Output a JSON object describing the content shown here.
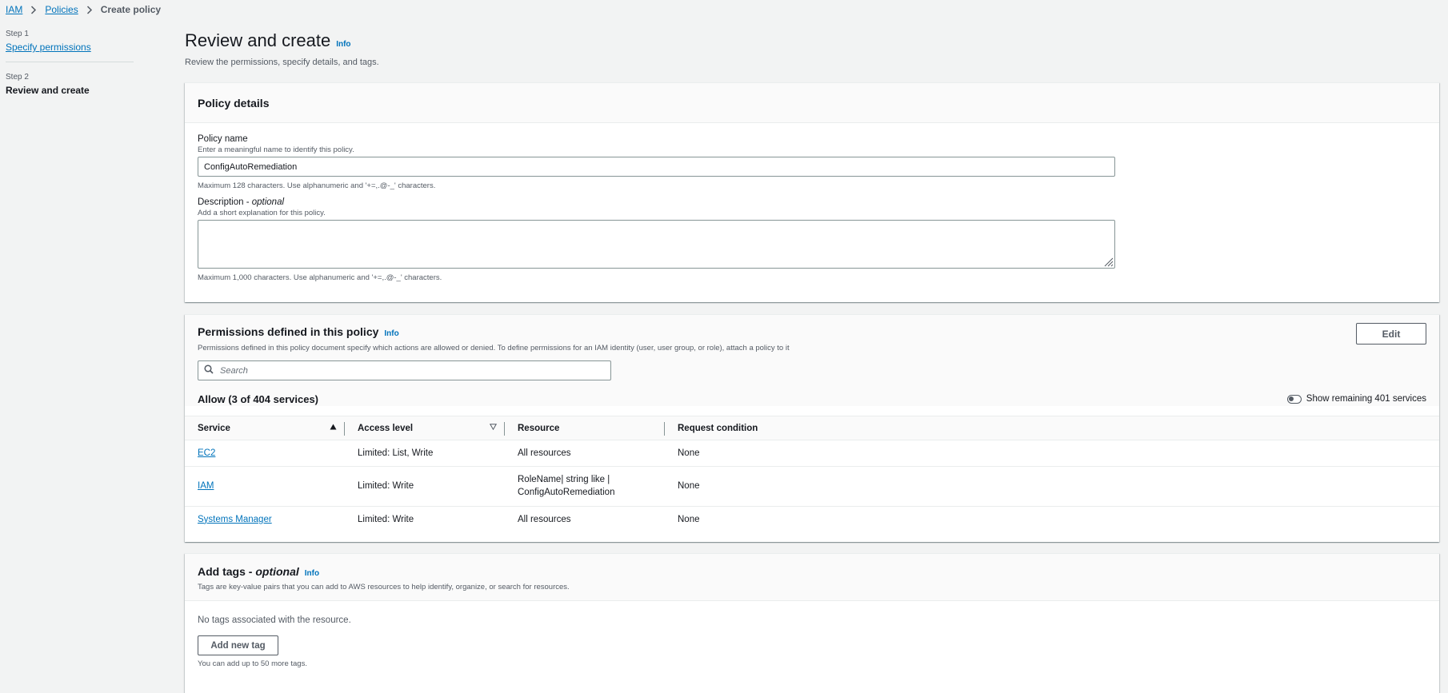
{
  "breadcrumb": {
    "iam": "IAM",
    "policies": "Policies",
    "current": "Create policy"
  },
  "steps": [
    {
      "label": "Step 1",
      "title": "Specify permissions"
    },
    {
      "label": "Step 2",
      "title": "Review and create"
    }
  ],
  "page": {
    "title": "Review and create",
    "info": "Info",
    "subtitle": "Review the permissions, specify details, and tags."
  },
  "details": {
    "title": "Policy details",
    "name_label": "Policy name",
    "name_desc": "Enter a meaningful name to identify this policy.",
    "name_value": "ConfigAutoRemediation",
    "name_hint": "Maximum 128 characters. Use alphanumeric and '+=,.@-_' characters.",
    "desc_label": "Description - ",
    "desc_optional": "optional",
    "desc_desc": "Add a short explanation for this policy.",
    "desc_value": "",
    "desc_hint": "Maximum 1,000 characters. Use alphanumeric and '+=,.@-_' characters."
  },
  "permissions": {
    "title": "Permissions defined in this policy",
    "info": "Info",
    "description": "Permissions defined in this policy document specify which actions are allowed or denied. To define permissions for an IAM identity (user, user group, or role), attach a policy to it",
    "edit_label": "Edit",
    "search_placeholder": "Search",
    "allow_title": "Allow (3 of 404 services)",
    "toggle_label": "Show remaining 401 services",
    "columns": [
      "Service",
      "Access level",
      "Resource",
      "Request condition"
    ],
    "rows": [
      {
        "service": "EC2",
        "access": "Limited: List, Write",
        "resource_1": "All resources",
        "resource_2": "",
        "condition": "None"
      },
      {
        "service": "IAM",
        "access": "Limited: Write",
        "resource_1": "RoleName| string like |",
        "resource_2": "ConfigAutoRemediation",
        "condition": "None"
      },
      {
        "service": "Systems Manager",
        "access": "Limited: Write",
        "resource_1": "All resources",
        "resource_2": "",
        "condition": "None"
      }
    ]
  },
  "tags": {
    "title": "Add tags - ",
    "optional": "optional",
    "info": "Info",
    "description": "Tags are key-value pairs that you can add to AWS resources to help identify, organize, or search for resources.",
    "empty": "No tags associated with the resource.",
    "add_label": "Add new tag",
    "hint": "You can add up to 50 more tags."
  },
  "colors": {
    "link": "#0073bb",
    "background": "#f2f3f3",
    "text": "#16191f",
    "muted": "#545b64"
  },
  "icons": [
    "chevron-right-icon",
    "info-link",
    "search-icon",
    "sort-ascending-icon",
    "sort-descending-icon",
    "toggle-off-icon",
    "resize-grip-icon"
  ]
}
